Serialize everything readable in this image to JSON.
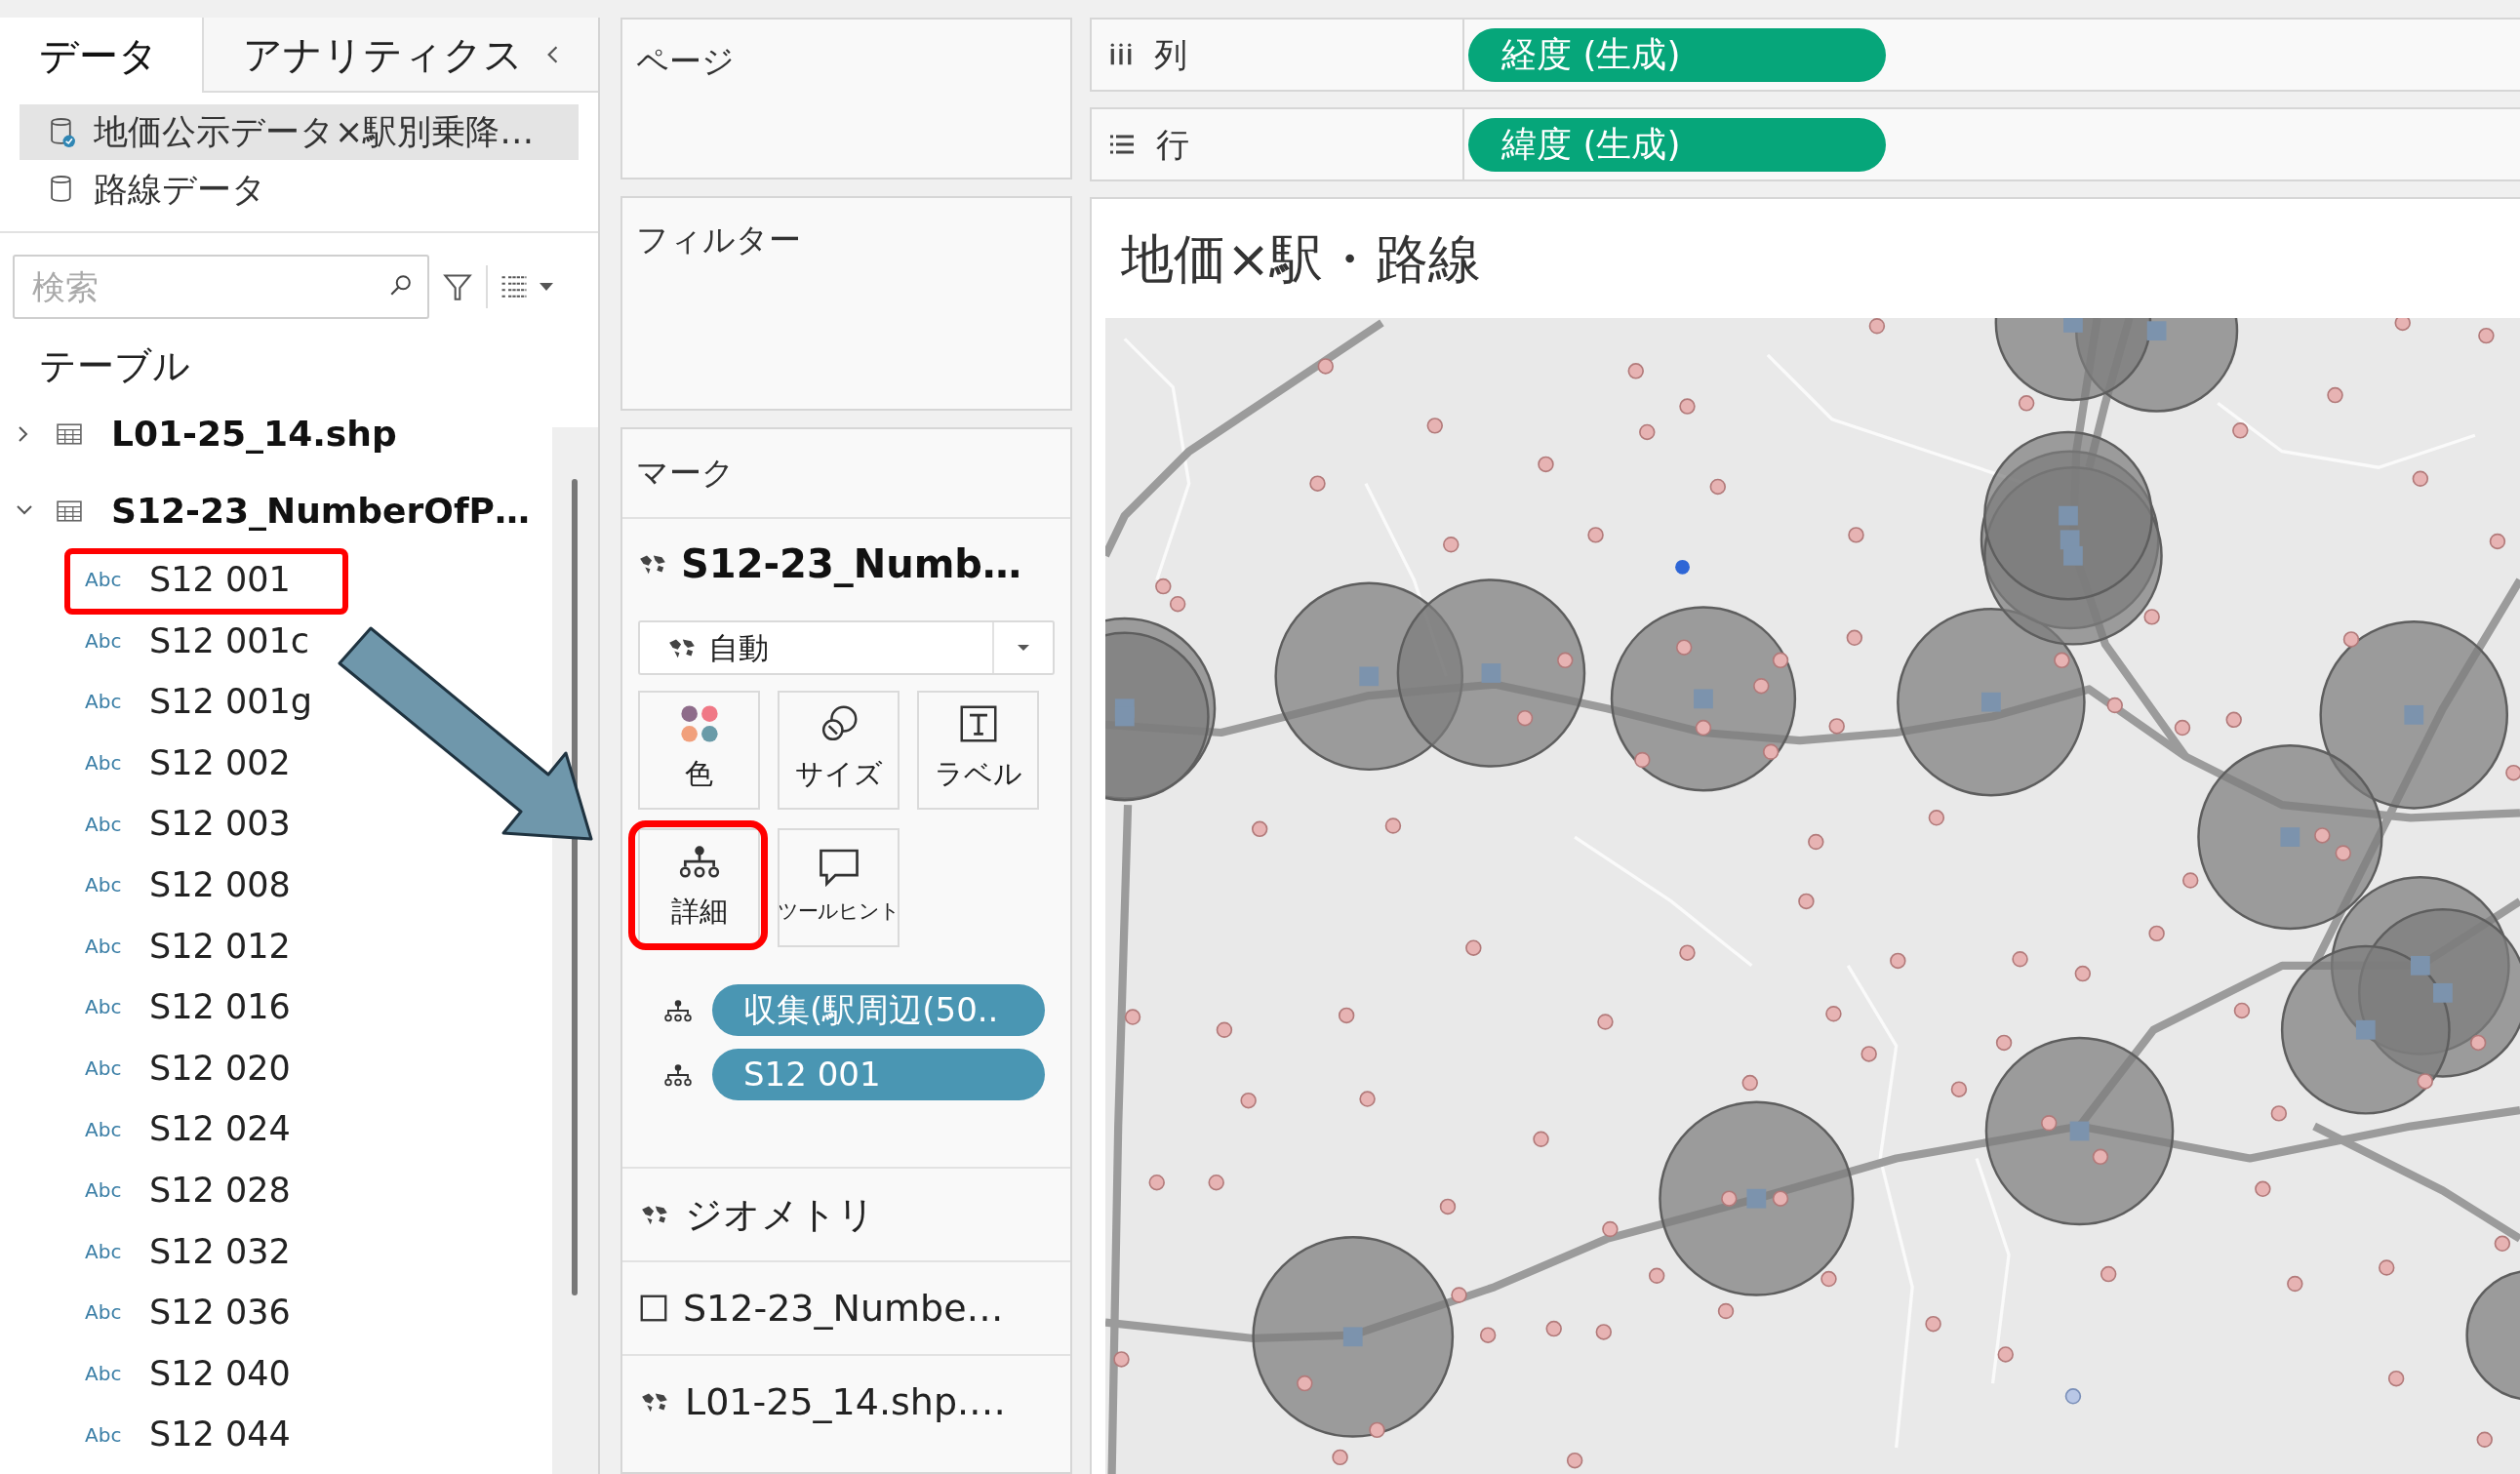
{
  "side_tabs": [
    {
      "label": "データ",
      "selected": true
    },
    {
      "label": "アナリティクス",
      "selected": false
    }
  ],
  "data_sources": [
    {
      "name": "地価公示データ×駅別乗降…",
      "selected": true,
      "primary": true
    },
    {
      "name": "路線データ",
      "selected": false,
      "primary": false
    }
  ],
  "search": {
    "placeholder": "検索"
  },
  "tables_heading": "テーブル",
  "tables": [
    {
      "name": "L01-25_14.shp",
      "expanded": false
    },
    {
      "name": "S12-23_NumberOfP…",
      "expanded": true,
      "fields": [
        {
          "type": "Abc",
          "name": "S12 001",
          "highlighted": true
        },
        {
          "type": "Abc",
          "name": "S12 001c",
          "highlighted": false
        },
        {
          "type": "Abc",
          "name": "S12 001g",
          "highlighted": false
        },
        {
          "type": "Abc",
          "name": "S12 002",
          "highlighted": false
        },
        {
          "type": "Abc",
          "name": "S12 003",
          "highlighted": false
        },
        {
          "type": "Abc",
          "name": "S12 008",
          "highlighted": false
        },
        {
          "type": "Abc",
          "name": "S12 012",
          "highlighted": false
        },
        {
          "type": "Abc",
          "name": "S12 016",
          "highlighted": false
        },
        {
          "type": "Abc",
          "name": "S12 020",
          "highlighted": false
        },
        {
          "type": "Abc",
          "name": "S12 024",
          "highlighted": false
        },
        {
          "type": "Abc",
          "name": "S12 028",
          "highlighted": false
        },
        {
          "type": "Abc",
          "name": "S12 032",
          "highlighted": false
        },
        {
          "type": "Abc",
          "name": "S12 036",
          "highlighted": false
        },
        {
          "type": "Abc",
          "name": "S12 040",
          "highlighted": false
        },
        {
          "type": "Abc",
          "name": "S12 044",
          "highlighted": false
        }
      ]
    }
  ],
  "pages_card": {
    "title": "ページ"
  },
  "filters_card": {
    "title": "フィルター"
  },
  "marks_card": {
    "title": "マーク",
    "layer": "S12-23_Numb…",
    "mark_type": "自動",
    "buttons": [
      {
        "kind": "color",
        "label": "色",
        "highlighted": false
      },
      {
        "kind": "size",
        "label": "サイズ",
        "highlighted": false
      },
      {
        "kind": "label",
        "label": "ラベル",
        "highlighted": false
      },
      {
        "kind": "detail",
        "label": "詳細",
        "highlighted": true
      },
      {
        "kind": "tooltip",
        "label": "ツールヒント",
        "highlighted": false
      }
    ],
    "pills": [
      {
        "kind": "detail",
        "label": "収集(駅周辺(50.."
      },
      {
        "kind": "detail",
        "label": "S12 001"
      }
    ],
    "layers": [
      {
        "kind": "map",
        "label": "ジオメトリ"
      },
      {
        "kind": "square",
        "label": "S12-23_Numbe…"
      },
      {
        "kind": "map",
        "label": "L01-25_14.shp.…"
      }
    ]
  },
  "shelves": [
    {
      "kind": "columns",
      "label": "列",
      "pills": [
        "経度 (生成)"
      ]
    },
    {
      "kind": "rows",
      "label": "行",
      "pills": [
        "緯度 (生成)"
      ]
    }
  ],
  "view": {
    "title": "地価×駅・路線"
  }
}
